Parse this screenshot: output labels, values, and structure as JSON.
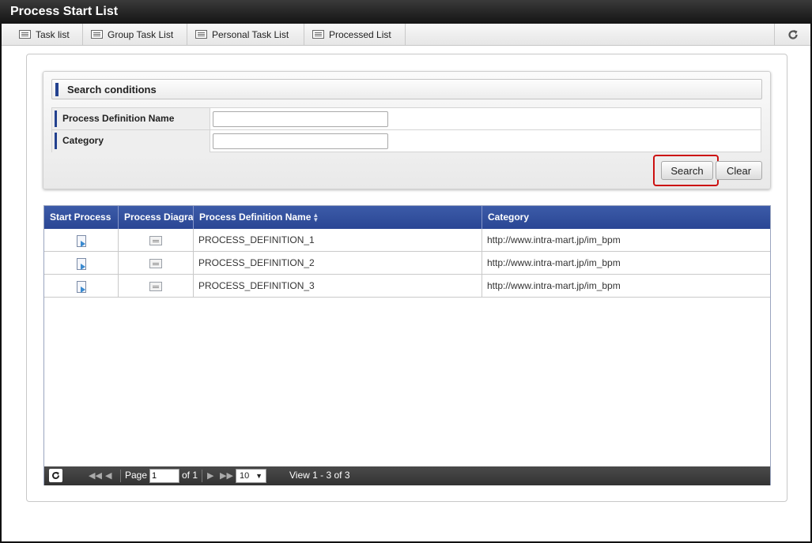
{
  "window": {
    "title": "Process Start List"
  },
  "tabs": [
    {
      "label": "Task list",
      "icon": "list-icon"
    },
    {
      "label": "Group Task List",
      "icon": "list-icon"
    },
    {
      "label": "Personal Task List",
      "icon": "list-icon"
    },
    {
      "label": "Processed List",
      "icon": "list-icon"
    }
  ],
  "toolbar": {
    "refresh_icon": "refresh-icon"
  },
  "search": {
    "header": "Search conditions",
    "fields": [
      {
        "label": "Process Definition Name",
        "value": "",
        "placeholder": ""
      },
      {
        "label": "Category",
        "value": "",
        "placeholder": ""
      }
    ],
    "search_label": "Search",
    "clear_label": "Clear",
    "highlight_color": "#cc1111"
  },
  "grid": {
    "columns": [
      "Start Process",
      "Process Diagram",
      "Process Definition Name",
      "Category"
    ],
    "sort_column": "Process Definition Name",
    "rows": [
      {
        "name": "PROCESS_DEFINITION_1",
        "category": "http://www.intra-mart.jp/im_bpm"
      },
      {
        "name": "PROCESS_DEFINITION_2",
        "category": "http://www.intra-mart.jp/im_bpm"
      },
      {
        "name": "PROCESS_DEFINITION_3",
        "category": "http://www.intra-mart.jp/im_bpm"
      }
    ],
    "header_color": "#2f4d9c"
  },
  "pager": {
    "page_label": "Page",
    "page_value": "1",
    "of_label": "of 1",
    "page_size": "10",
    "view_text": "View 1 - 3 of 3"
  }
}
